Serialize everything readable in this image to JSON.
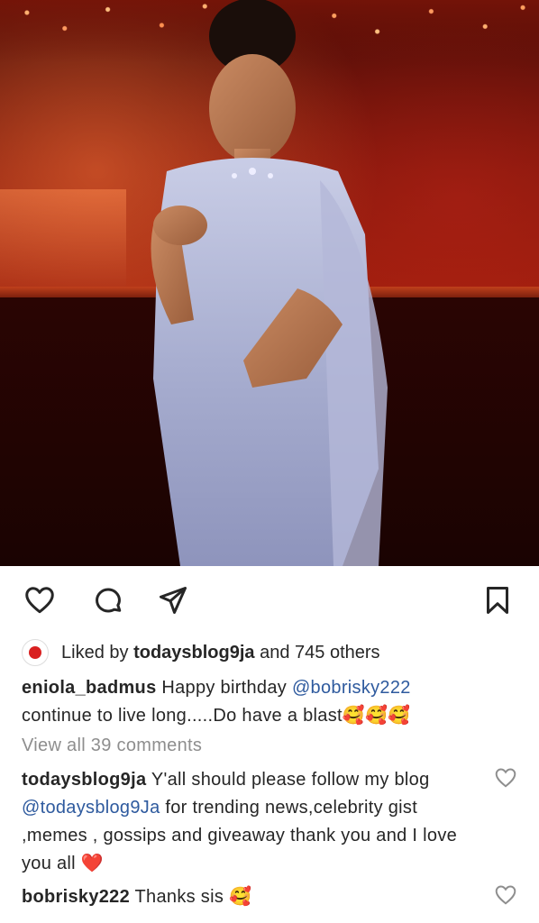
{
  "post": {
    "likes": {
      "prefix": "Liked by",
      "user": "todaysblog9ja",
      "suffix": "and 745 others"
    },
    "caption": {
      "username": "eniola_badmus",
      "text_before": "Happy birthday",
      "mention": "@bobrisky222",
      "text_after": "continue to live long.....Do have a blast🥰🥰🥰"
    },
    "view_all": "View all 39 comments",
    "comments": [
      {
        "username": "todaysblog9ja",
        "text_before": "Y'all should please follow my blog",
        "mention": "@todaysblog9Ja",
        "text_after": "for trending news,celebrity gist ,memes , gossips and giveaway thank you and I love you all ❤️"
      },
      {
        "username": "bobrisky222",
        "text": "Thanks sis 🥰"
      }
    ]
  },
  "icons": {
    "like": "heart-icon",
    "comment": "comment-bubble-icon",
    "share": "paper-plane-icon",
    "save": "bookmark-icon"
  },
  "colors": {
    "text": "#262626",
    "muted": "#8e8e8e",
    "mention": "#2e5a9e"
  }
}
